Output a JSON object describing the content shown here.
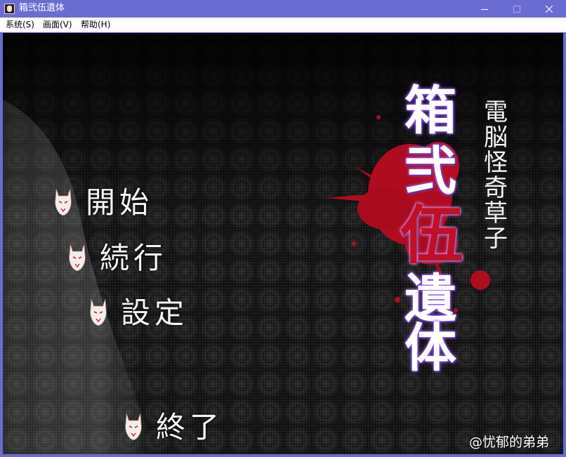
{
  "window": {
    "title": "箱弐伍遺体",
    "controls": {
      "minimize_icon": "minimize-icon",
      "maximize_icon": "maximize-icon",
      "close_icon": "close-icon"
    }
  },
  "menubar": {
    "items": [
      {
        "label": "系统(S)"
      },
      {
        "label": "画面(V)"
      },
      {
        "label": "帮助(H)"
      }
    ]
  },
  "title_screen": {
    "logo": {
      "main_chars": [
        "箱",
        "弐",
        "伍",
        "遺",
        "体"
      ],
      "subtitle_chars": [
        "電",
        "脳",
        "怪",
        "奇",
        "草",
        "子"
      ]
    },
    "menu": [
      {
        "label": "開始",
        "icon": "fox-mask-icon"
      },
      {
        "label": "続行",
        "icon": "fox-mask-icon"
      },
      {
        "label": "設定",
        "icon": "fox-mask-icon"
      },
      {
        "label": "終了",
        "icon": "fox-mask-icon"
      }
    ],
    "watermark": "@忧郁的弟弟"
  },
  "colors": {
    "titlebar": "#6b6cd2",
    "logo_red": "#c01028",
    "blood_red": "#b00c20",
    "logo_glow": "#8a4cff",
    "background": "#0b0b0b"
  }
}
